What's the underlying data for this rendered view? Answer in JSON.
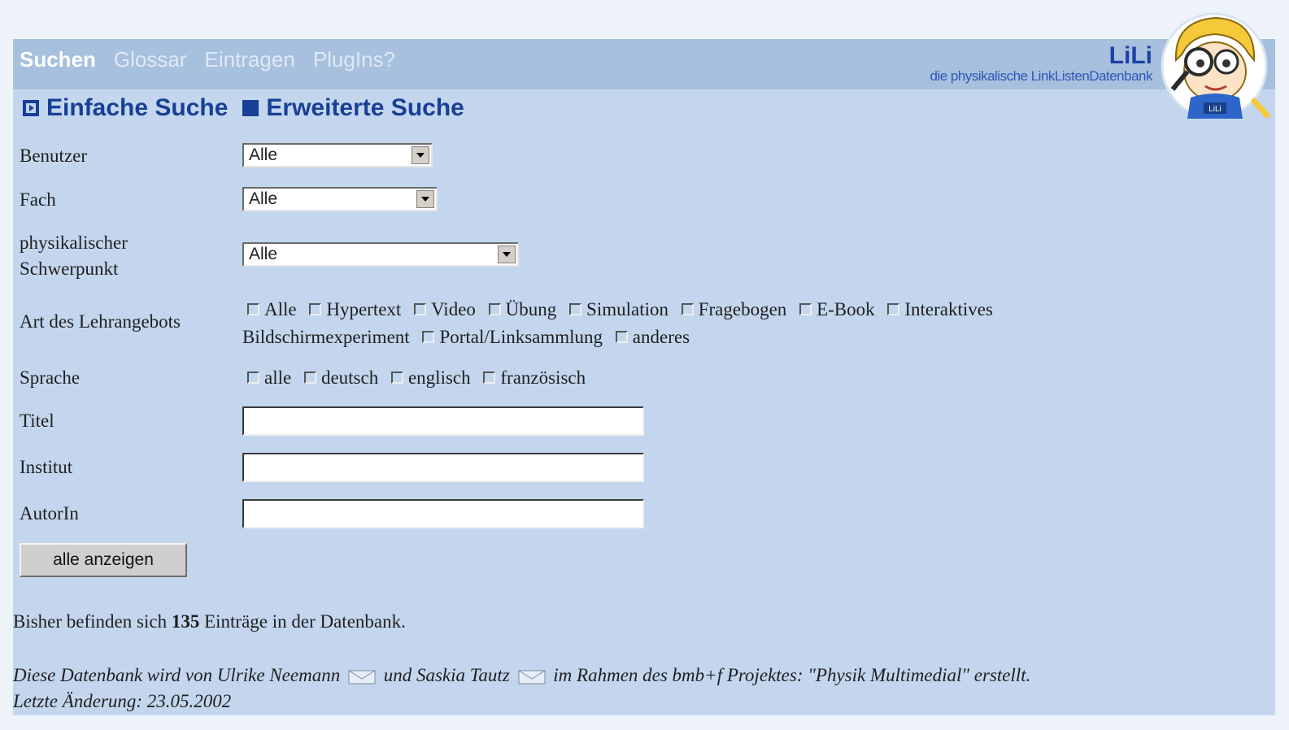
{
  "nav": {
    "items": [
      "Suchen",
      "Glossar",
      "Eintragen",
      "PlugIns?"
    ]
  },
  "brand": {
    "name": "LiLi",
    "subtitle": "die physikalische LinkListenDatenbank",
    "mascot_badge": "LiLi"
  },
  "modes": {
    "simple": "Einfache Suche",
    "advanced": "Erweiterte Suche"
  },
  "fields": {
    "benutzer": {
      "label": "Benutzer",
      "value": "Alle"
    },
    "fach": {
      "label": "Fach",
      "value": "Alle"
    },
    "schwerpunkt": {
      "label1": "physikalischer",
      "label2": "Schwerpunkt",
      "value": "Alle"
    },
    "lehrangebot": {
      "label": "Art des Lehrangebots",
      "options": [
        "Alle",
        "Hypertext",
        "Video",
        "Übung",
        "Simulation",
        "Fragebogen",
        "E-Book",
        "Interaktives",
        "Bildschirmexperiment",
        "Portal/Linksammlung",
        "anderes"
      ]
    },
    "sprache": {
      "label": "Sprache",
      "options": [
        "alle",
        "deutsch",
        "englisch",
        "französisch"
      ]
    },
    "titel": {
      "label": "Titel",
      "value": ""
    },
    "institut": {
      "label": "Institut",
      "value": ""
    },
    "autorin": {
      "label": "AutorIn",
      "value": ""
    }
  },
  "button": {
    "label": "alle anzeigen"
  },
  "count": {
    "prefix": "Bisher befinden sich",
    "number": "135",
    "suffix": "Einträge in der Datenbank."
  },
  "footer": {
    "part1": "Diese Datenbank wird von Ulrike Neemann",
    "part2": "und Saskia Tautz",
    "part3": "im Rahmen des bmb+f Projektes: \"Physik Multimedial\" erstellt.",
    "updated": "Letzte Änderung: 23.05.2002"
  },
  "colors": {
    "background": "#c3d6ee",
    "topbar": "#a6c0dd",
    "heading": "#193f96"
  }
}
